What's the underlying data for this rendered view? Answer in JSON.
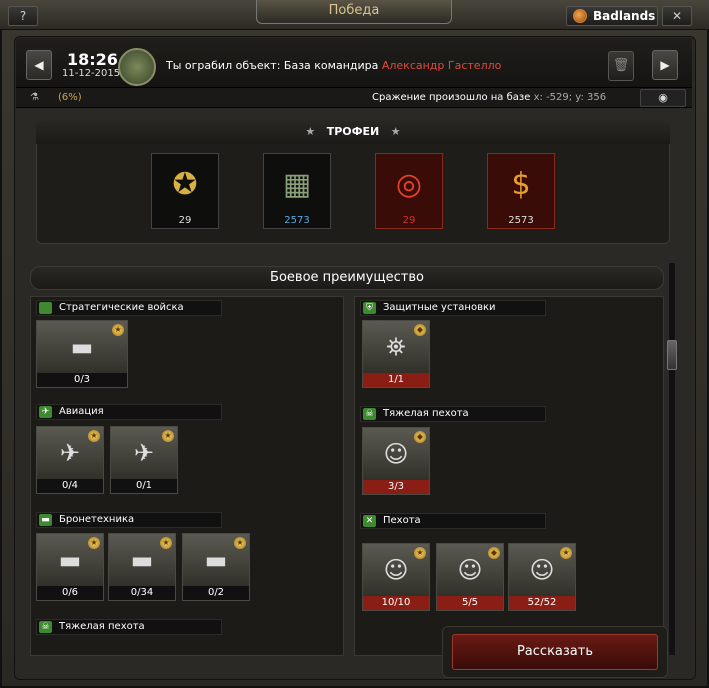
{
  "window": {
    "title": "Победа",
    "help_label": "?",
    "server_name": "Badlands",
    "close_label": "✕"
  },
  "report": {
    "time": "18:26",
    "date": "11-12-2015",
    "message_prefix": "Ты ограбил объект: База командира",
    "commander": "Александр Гастелло",
    "percent": "(6%)",
    "battle_text": "Сражение произошло на базе",
    "coord": "x: -529; y: 356",
    "prev_label": "◀",
    "next_label": "▶"
  },
  "trophies": {
    "title": "ТРОФЕИ",
    "items": [
      {
        "icon": "medal-wreath-icon",
        "value": "29"
      },
      {
        "icon": "resources-crate-icon",
        "value": "2573"
      },
      {
        "icon": "target-icon",
        "value": "29"
      },
      {
        "icon": "money-bag-icon",
        "value": "2573"
      }
    ]
  },
  "advantage": {
    "title": "Боевое преимущество",
    "left": [
      {
        "name": "Стратегические войска",
        "units": [
          {
            "count": "0/3"
          }
        ]
      },
      {
        "name": "Авиация",
        "units": [
          {
            "count": "0/4"
          },
          {
            "count": "0/1"
          }
        ]
      },
      {
        "name": "Бронетехника",
        "units": [
          {
            "count": "0/6"
          },
          {
            "count": "0/34"
          },
          {
            "count": "0/2"
          }
        ]
      },
      {
        "name": "Тяжелая пехота",
        "units": []
      }
    ],
    "right": [
      {
        "name": "Защитные установки",
        "units": [
          {
            "count": "1/1"
          }
        ]
      },
      {
        "name": "Тяжелая пехота",
        "units": [
          {
            "count": "3/3"
          }
        ]
      },
      {
        "name": "Пехота",
        "units": [
          {
            "count": "10/10"
          },
          {
            "count": "5/5"
          },
          {
            "count": "52/52"
          }
        ]
      }
    ]
  },
  "actions": {
    "tell_label": "Рассказать"
  }
}
